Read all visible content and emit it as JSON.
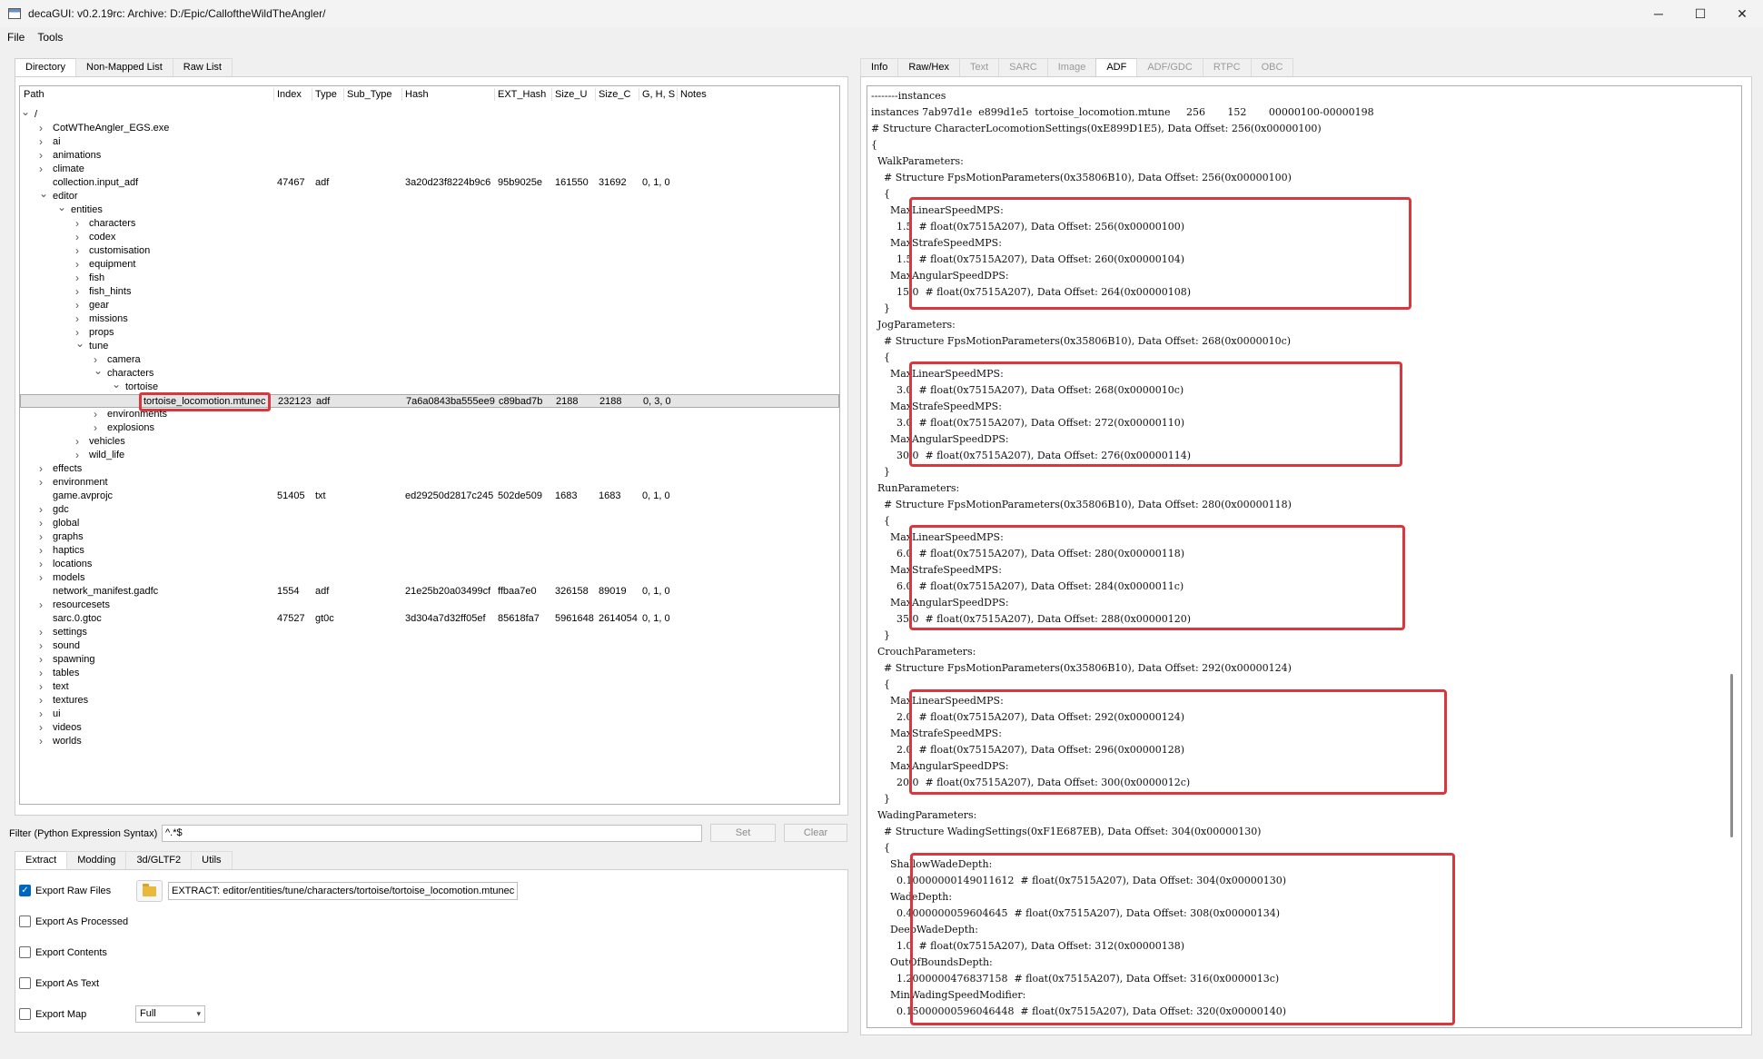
{
  "window": {
    "title": "decaGUI: v0.2.19rc: Archive: D:/Epic/CalloftheWildTheAngler/",
    "minimize": "─",
    "maximize": "☐",
    "close": "✕"
  },
  "menu": [
    "File",
    "Tools"
  ],
  "left_tabs": [
    "Directory",
    "Non-Mapped List",
    "Raw List"
  ],
  "right_tabs": [
    "Info",
    "Raw/Hex",
    "Text",
    "SARC",
    "Image",
    "ADF",
    "ADF/GDC",
    "RTPC",
    "OBC"
  ],
  "columns": [
    "Path",
    "Index",
    "Type",
    "Sub_Type",
    "Hash",
    "EXT_Hash",
    "Size_U",
    "Size_C",
    "G, H, S",
    "Notes"
  ],
  "tree": [
    {
      "name": "/",
      "exp": "open"
    },
    {
      "name": "CotWTheAngler_EGS.exe",
      "exp": "closed"
    },
    {
      "name": "ai",
      "exp": "closed"
    },
    {
      "name": "animations",
      "exp": "closed"
    },
    {
      "name": "climate",
      "exp": "closed"
    },
    {
      "name": "collection.input_adf",
      "exp": "none",
      "index": "47467",
      "type": "adf",
      "hash": "3a20d23f8224b9c6",
      "ext": "95b9025e",
      "su": "161550",
      "sc": "31692",
      "ghs": "0, 1, 0"
    },
    {
      "name": "editor",
      "exp": "open"
    },
    {
      "name": "entities",
      "exp": "open"
    },
    {
      "name": "characters",
      "exp": "closed"
    },
    {
      "name": "codex",
      "exp": "closed"
    },
    {
      "name": "customisation",
      "exp": "closed"
    },
    {
      "name": "equipment",
      "exp": "closed"
    },
    {
      "name": "fish",
      "exp": "closed"
    },
    {
      "name": "fish_hints",
      "exp": "closed"
    },
    {
      "name": "gear",
      "exp": "closed"
    },
    {
      "name": "missions",
      "exp": "closed"
    },
    {
      "name": "props",
      "exp": "closed"
    },
    {
      "name": "tune",
      "exp": "open"
    },
    {
      "name": "camera",
      "exp": "closed"
    },
    {
      "name": "characters",
      "exp": "open"
    },
    {
      "name": "tortoise",
      "exp": "open"
    },
    {
      "name": "tortoise_locomotion.mtunec",
      "exp": "none",
      "index": "232123",
      "type": "adf",
      "hash": "7a6a0843ba555ee9",
      "ext": "c89bad7b",
      "su": "2188",
      "sc": "2188",
      "ghs": "0, 3, 0"
    },
    {
      "name": "environments",
      "exp": "closed"
    },
    {
      "name": "explosions",
      "exp": "closed"
    },
    {
      "name": "vehicles",
      "exp": "closed"
    },
    {
      "name": "wild_life",
      "exp": "closed"
    },
    {
      "name": "effects",
      "exp": "closed"
    },
    {
      "name": "environment",
      "exp": "closed"
    },
    {
      "name": "game.avprojc",
      "exp": "none",
      "index": "51405",
      "type": "txt",
      "hash": "ed29250d2817c245",
      "ext": "502de509",
      "su": "1683",
      "sc": "1683",
      "ghs": "0, 1, 0"
    },
    {
      "name": "gdc",
      "exp": "closed"
    },
    {
      "name": "global",
      "exp": "closed"
    },
    {
      "name": "graphs",
      "exp": "closed"
    },
    {
      "name": "haptics",
      "exp": "closed"
    },
    {
      "name": "locations",
      "exp": "closed"
    },
    {
      "name": "models",
      "exp": "closed"
    },
    {
      "name": "network_manifest.gadfc",
      "exp": "none",
      "index": "1554",
      "type": "adf",
      "hash": "21e25b20a03499cf",
      "ext": "ffbaa7e0",
      "su": "326158",
      "sc": "89019",
      "ghs": "0, 1, 0"
    },
    {
      "name": "resourcesets",
      "exp": "closed"
    },
    {
      "name": "sarc.0.gtoc",
      "exp": "none",
      "index": "47527",
      "type": "gt0c",
      "hash": "3d304a7d32ff05ef",
      "ext": "85618fa7",
      "su": "5961648",
      "sc": "2614054",
      "ghs": "0, 1, 0"
    },
    {
      "name": "settings",
      "exp": "closed"
    },
    {
      "name": "sound",
      "exp": "closed"
    },
    {
      "name": "spawning",
      "exp": "closed"
    },
    {
      "name": "tables",
      "exp": "closed"
    },
    {
      "name": "text",
      "exp": "closed"
    },
    {
      "name": "textures",
      "exp": "closed"
    },
    {
      "name": "ui",
      "exp": "closed"
    },
    {
      "name": "videos",
      "exp": "closed"
    },
    {
      "name": "worlds",
      "exp": "closed"
    }
  ],
  "filter": {
    "label": "Filter (Python Expression Syntax)",
    "value": "^.*$",
    "set": "Set",
    "clear": "Clear"
  },
  "bottom_tabs": [
    "Extract",
    "Modding",
    "3d/GLTF2",
    "Utils"
  ],
  "options": [
    {
      "label": "Export Raw Files",
      "checked": true
    },
    {
      "label": "Export As Processed",
      "checked": false
    },
    {
      "label": "Export Contents",
      "checked": false
    },
    {
      "label": "Export As Text",
      "checked": false
    },
    {
      "label": "Export Map",
      "checked": false
    }
  ],
  "extract_path": "EXTRACT: editor/entities/tune/characters/tortoise/tortoise_locomotion.mtunec",
  "map_select": "Full",
  "adf_lines": [
    "--------instances",
    "instances 7ab97d1e  e899d1e5  tortoise_locomotion.mtune     256       152       00000100-00000198",
    "# Structure CharacterLocomotionSettings(0xE899D1E5), Data Offset: 256(0x00000100)",
    "{",
    "  WalkParameters:",
    "    # Structure FpsMotionParameters(0x35806B10), Data Offset: 256(0x00000100)",
    "    {",
    "      MaxLinearSpeedMPS:",
    "        1.5  # float(0x7515A207), Data Offset: 256(0x00000100)",
    "      MaxStrafeSpeedMPS:",
    "        1.5  # float(0x7515A207), Data Offset: 260(0x00000104)",
    "      MaxAngularSpeedDPS:",
    "        15.0  # float(0x7515A207), Data Offset: 264(0x00000108)",
    "    }",
    "  JogParameters:",
    "    # Structure FpsMotionParameters(0x35806B10), Data Offset: 268(0x0000010c)",
    "    {",
    "      MaxLinearSpeedMPS:",
    "        3.0  # float(0x7515A207), Data Offset: 268(0x0000010c)",
    "      MaxStrafeSpeedMPS:",
    "        3.0  # float(0x7515A207), Data Offset: 272(0x00000110)",
    "      MaxAngularSpeedDPS:",
    "        30.0  # float(0x7515A207), Data Offset: 276(0x00000114)",
    "    }",
    "  RunParameters:",
    "    # Structure FpsMotionParameters(0x35806B10), Data Offset: 280(0x00000118)",
    "    {",
    "      MaxLinearSpeedMPS:",
    "        6.0  # float(0x7515A207), Data Offset: 280(0x00000118)",
    "      MaxStrafeSpeedMPS:",
    "        6.0  # float(0x7515A207), Data Offset: 284(0x0000011c)",
    "      MaxAngularSpeedDPS:",
    "        35.0  # float(0x7515A207), Data Offset: 288(0x00000120)",
    "    }",
    "  CrouchParameters:",
    "    # Structure FpsMotionParameters(0x35806B10), Data Offset: 292(0x00000124)",
    "    {",
    "      MaxLinearSpeedMPS:",
    "        2.0  # float(0x7515A207), Data Offset: 292(0x00000124)",
    "      MaxStrafeSpeedMPS:",
    "        2.0  # float(0x7515A207), Data Offset: 296(0x00000128)",
    "      MaxAngularSpeedDPS:",
    "        20.0  # float(0x7515A207), Data Offset: 300(0x0000012c)",
    "    }",
    "  WadingParameters:",
    "    # Structure WadingSettings(0xF1E687EB), Data Offset: 304(0x00000130)",
    "    {",
    "      ShallowWadeDepth:",
    "        0.10000000149011612  # float(0x7515A207), Data Offset: 304(0x00000130)",
    "      WadeDepth:",
    "        0.4000000059604645  # float(0x7515A207), Data Offset: 308(0x00000134)",
    "      DeepWadeDepth:",
    "        1.0  # float(0x7515A207), Data Offset: 312(0x00000138)",
    "      OutOfBoundsDepth:",
    "        1.2000000476837158  # float(0x7515A207), Data Offset: 316(0x0000013c)",
    "      MinWadingSpeedModifier:",
    "        0.15000000596046448  # float(0x7515A207), Data Offset: 320(0x00000140)"
  ]
}
